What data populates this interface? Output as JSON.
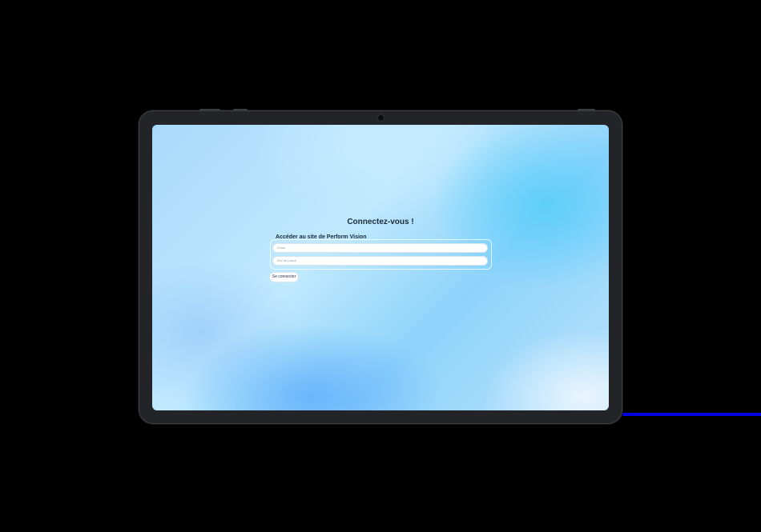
{
  "login": {
    "title": "Connectez-vous !",
    "legend": "Accéder au site de Perform Vision",
    "email_placeholder": "Email",
    "password_placeholder": "Mot de passe",
    "submit_label": "Se connecter"
  },
  "colors": {
    "background": "#000000",
    "device_frame": "#232427",
    "text": "#1d2b3a",
    "accent_bar": "#0000e0"
  }
}
